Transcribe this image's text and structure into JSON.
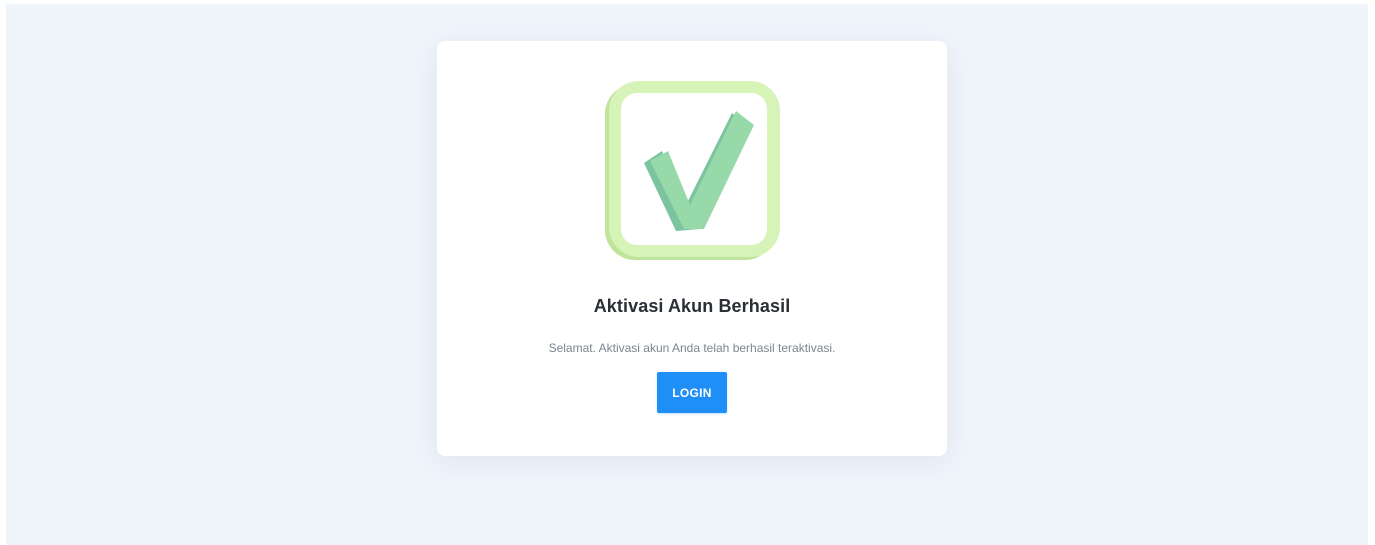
{
  "card": {
    "title": "Aktivasi Akun Berhasil",
    "message": "Selamat. Aktivasi akun Anda telah berhasil teraktivasi.",
    "login_label": "LOGIN",
    "icon": "checkmark-badge-icon"
  },
  "colors": {
    "page_background": "#f0f4fb",
    "card_background": "#ffffff",
    "button": "#1f8ff7",
    "check_frame": "#d4f2b3",
    "check_mark": "#93d5a5"
  }
}
